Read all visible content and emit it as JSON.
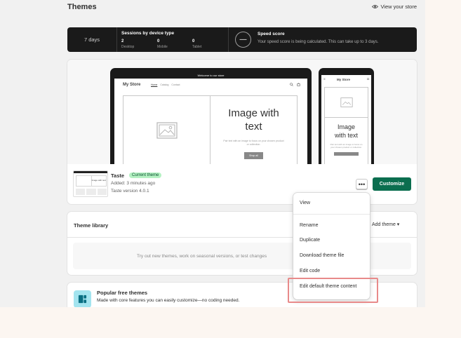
{
  "header": {
    "title": "Themes",
    "view_store": "View your store",
    "view_store_icon": "eye-icon"
  },
  "stats": {
    "period": "7 days",
    "sessions": {
      "title": "Sessions by device type",
      "columns": [
        {
          "value": "2",
          "label": "Desktop"
        },
        {
          "value": "0",
          "label": "Mobile"
        },
        {
          "value": "0",
          "label": "Tablet"
        }
      ]
    },
    "speed": {
      "ring_text": "—",
      "title": "Speed score",
      "description": "Your speed score is being calculated. This can take up to 3 days."
    }
  },
  "preview": {
    "announcement": "Welcome to our store",
    "store_name": "My Store",
    "nav_links": [
      "Home",
      "Catalog",
      "Contact"
    ],
    "hero_heading_line1": "Image with",
    "hero_heading_line2": "text",
    "hero_body": "Pair text with an image to focus on your chosen product or collection.",
    "hero_button": "Shop all",
    "phone_heading_line1": "Image",
    "phone_heading_line2": "with text",
    "phone_body": "Pair text with an image to focus on your chosen product or collection."
  },
  "current_theme": {
    "name": "Taste",
    "badge": "Current theme",
    "added": "Added: 3 minutes ago",
    "version": "Taste version 4.0.1",
    "thumb_text": "Image with text",
    "more_label": "•••",
    "customize_label": "Customize"
  },
  "library": {
    "title": "Theme library",
    "add_theme": "Add theme ▾",
    "empty_text": "Try out new themes, work on seasonal versions, or test changes"
  },
  "popular": {
    "title": "Popular free themes",
    "subtitle": "Made with core features you can easily customize—no coding needed."
  },
  "menu": {
    "items": [
      "View",
      "Rename",
      "Duplicate",
      "Download theme file",
      "Edit code",
      "Edit default theme content"
    ]
  },
  "colors": {
    "primary": "#0b6e4f",
    "badge_bg": "#b4f1c2",
    "highlight": "#e88a8a"
  }
}
